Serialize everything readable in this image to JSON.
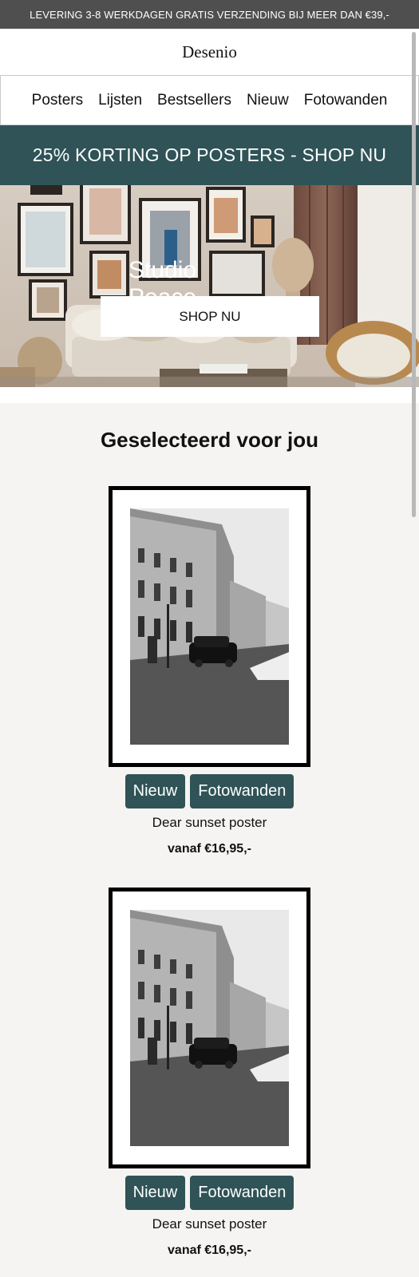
{
  "announcement": "LEVERING 3-8 WERKDAGEN GRATIS VERZENDING BIJ MEER DAN €39,-",
  "brand": "Desenio",
  "nav": [
    "Posters",
    "Lijsten",
    "Bestsellers",
    "Nieuw",
    "Fotowanden"
  ],
  "promo": "25% KORTING OP POSTERS - SHOP NU",
  "hero": {
    "title": "Studio Peace",
    "button": "SHOP NU"
  },
  "section_title": "Geselecteerd voor jou",
  "products": [
    {
      "tags": [
        "Nieuw",
        "Fotowanden"
      ],
      "name": "Dear sunset poster",
      "price": "vanaf €16,95,-"
    },
    {
      "tags": [
        "Nieuw",
        "Fotowanden"
      ],
      "name": "Dear sunset poster",
      "price": "vanaf €16,95,-"
    }
  ],
  "colors": {
    "accent": "#2f5357",
    "topbar": "#4f4f4f",
    "page_bg": "#f5f4f2"
  }
}
